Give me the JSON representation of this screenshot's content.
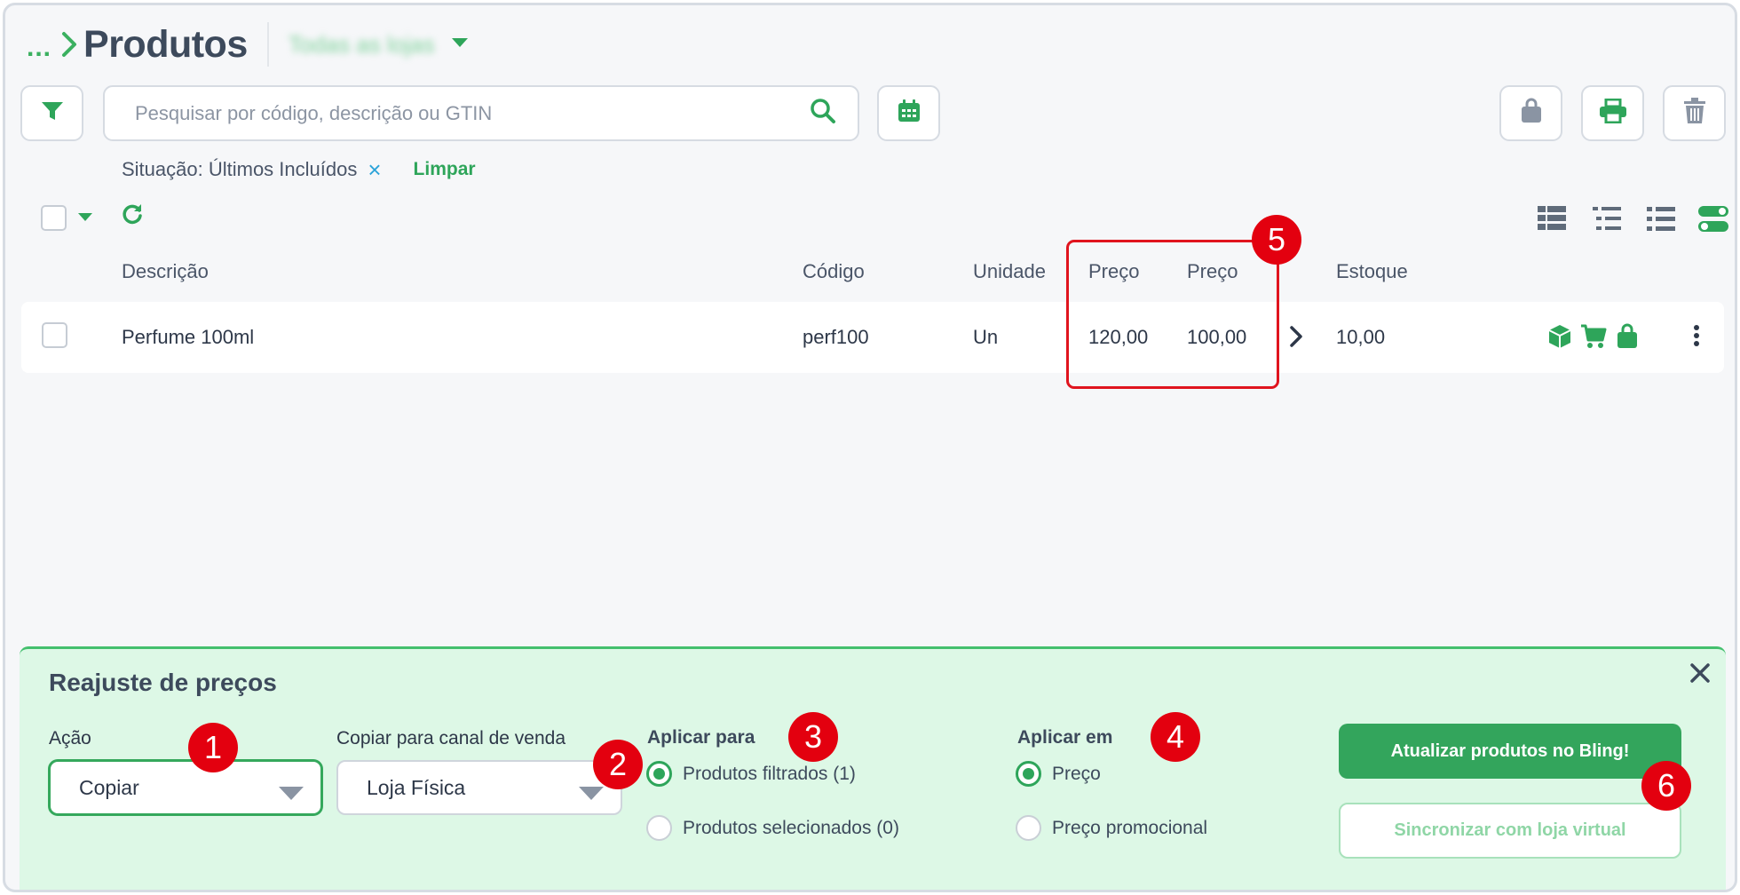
{
  "header": {
    "breadcrumb": "...",
    "title": "Produtos",
    "store_filter": "Todas as lojas"
  },
  "search": {
    "placeholder": "Pesquisar por código, descrição ou GTIN",
    "value": ""
  },
  "filter": {
    "label": "Situação: Últimos Incluídos",
    "remove": "×",
    "clear": "Limpar"
  },
  "table": {
    "columns": {
      "descricao": "Descrição",
      "codigo": "Código",
      "unidade": "Unidade",
      "preco1": "Preço",
      "preco2": "Preço",
      "estoque": "Estoque"
    },
    "rows": [
      {
        "descricao": "Perfume 100ml",
        "codigo": "perf100",
        "unidade": "Un",
        "preco1": "120,00",
        "preco2": "100,00",
        "estoque": "10,00"
      }
    ]
  },
  "panel": {
    "title": "Reajuste de preços",
    "acao_label": "Ação",
    "acao_value": "Copiar",
    "canal_label": "Copiar para canal de venda",
    "canal_value": "Loja Física",
    "aplicar_para_label": "Aplicar para",
    "aplicar_para_options": [
      "Produtos filtrados (1)",
      "Produtos selecionados (0)"
    ],
    "aplicar_em_label": "Aplicar em",
    "aplicar_em_options": [
      "Preço",
      "Preço promocional"
    ],
    "btn_update": "Atualizar produtos no Bling!",
    "btn_sync": "Sincronizar com loja virtual"
  },
  "annotations": [
    "1",
    "2",
    "3",
    "4",
    "5",
    "6"
  ],
  "colors": {
    "accent_green": "#2ea55a",
    "panel_bg": "#ddf8e6",
    "annotation_red": "#e3000f"
  },
  "icons": [
    "chevron-right-icon",
    "caret-down-icon",
    "filter-icon",
    "search-icon",
    "calendar-icon",
    "bag-icon",
    "print-icon",
    "trash-icon",
    "refresh-icon",
    "view-compact-icon",
    "view-list-icon",
    "view-detailed-icon",
    "toggle-icon",
    "box-icon",
    "cart-icon",
    "kebab-icon",
    "close-icon"
  ]
}
